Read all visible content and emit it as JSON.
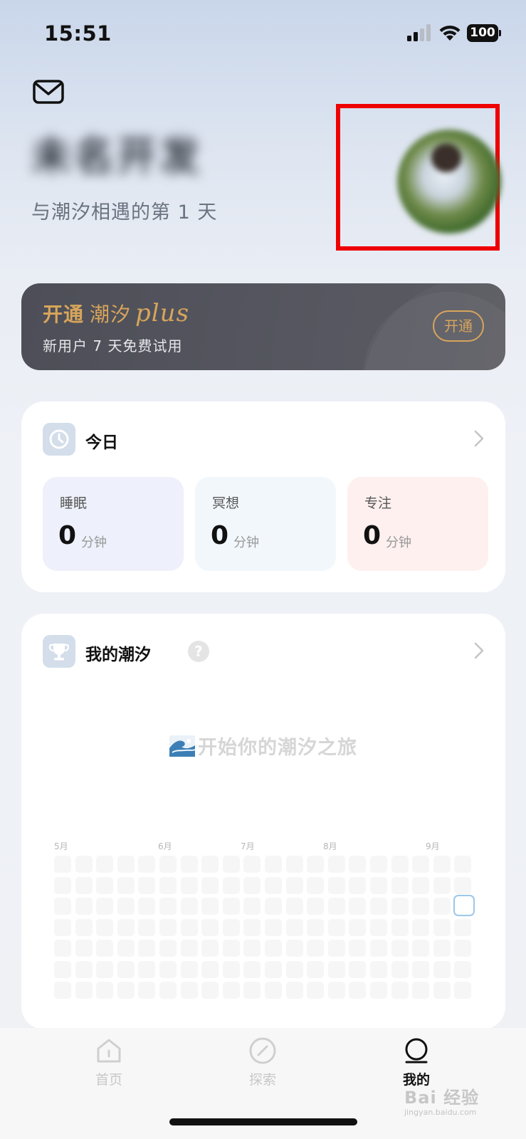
{
  "status_bar": {
    "time": "15:51",
    "battery": "100",
    "icons": [
      "signal-icon",
      "wifi-icon",
      "battery-icon"
    ]
  },
  "header": {
    "mail_icon": "mail-icon",
    "username": "未名开发",
    "days_text": "与潮汐相遇的第 1 天",
    "avatar_highlight_color": "#ee0000"
  },
  "plus_banner": {
    "open_word": "开通",
    "brand": "潮汐",
    "plus_script": "plus",
    "subtitle": "新用户 7 天免费试用",
    "button_label": "开通",
    "accent_color": "#d7a55b"
  },
  "today": {
    "title": "今日",
    "icon": "clock-icon",
    "stats": [
      {
        "label": "睡眠",
        "value": "0",
        "unit": "分钟"
      },
      {
        "label": "冥想",
        "value": "0",
        "unit": "分钟"
      },
      {
        "label": "专注",
        "value": "0",
        "unit": "分钟"
      }
    ]
  },
  "my_tide": {
    "title": "我的潮汐",
    "icon": "trophy-icon",
    "help": "?",
    "empty_text": "开始你的潮汐之旅",
    "months": [
      "5月",
      "6月",
      "7月",
      "8月",
      "9月"
    ]
  },
  "tab_bar": {
    "tabs": [
      {
        "label": "首页",
        "icon": "home-icon",
        "active": false
      },
      {
        "label": "探索",
        "icon": "compass-icon",
        "active": false
      },
      {
        "label": "我的",
        "icon": "profile-icon",
        "active": true
      }
    ]
  },
  "watermark": {
    "text": "Bai 经验",
    "sub": "jingyan.baidu.com"
  }
}
